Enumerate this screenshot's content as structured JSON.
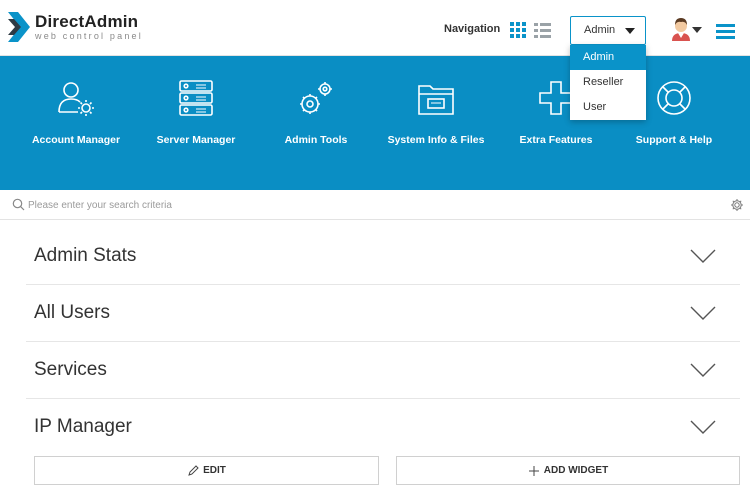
{
  "header": {
    "logo_name": "DirectAdmin",
    "logo_sub": "web control panel",
    "nav_label": "Navigation",
    "role_current": "Admin",
    "role_options": [
      "Admin",
      "Reseller",
      "User"
    ]
  },
  "features": [
    {
      "label": "Account Manager",
      "icon": "account-manager-icon"
    },
    {
      "label": "Server Manager",
      "icon": "server-manager-icon"
    },
    {
      "label": "Admin Tools",
      "icon": "admin-tools-icon"
    },
    {
      "label": "System Info & Files",
      "icon": "system-info-icon"
    },
    {
      "label": "Extra Features",
      "icon": "extra-features-icon"
    },
    {
      "label": "Support & Help",
      "icon": "support-help-icon"
    }
  ],
  "search": {
    "placeholder": "Please enter your search criteria"
  },
  "widgets": [
    {
      "title": "Admin Stats"
    },
    {
      "title": "All Users"
    },
    {
      "title": "Services"
    },
    {
      "title": "IP Manager"
    }
  ],
  "actions": {
    "edit": "EDIT",
    "add_widget": "ADD WIDGET"
  },
  "colors": {
    "accent": "#0a93c9",
    "banner": "#0a8ec4"
  }
}
